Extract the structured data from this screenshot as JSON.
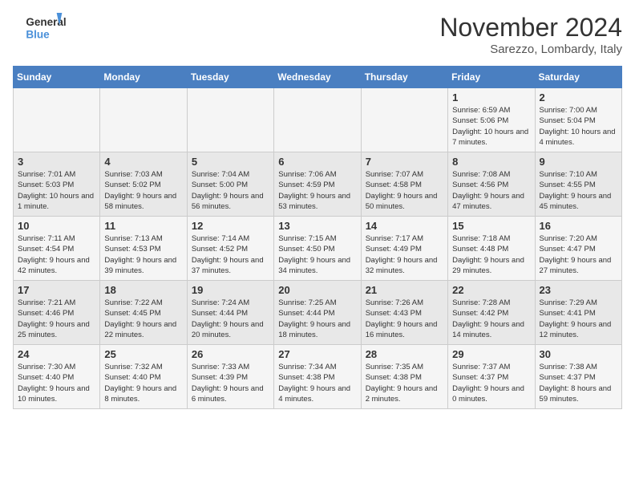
{
  "logo": {
    "line1": "General",
    "line2": "Blue"
  },
  "title": "November 2024",
  "location": "Sarezzo, Lombardy, Italy",
  "weekdays": [
    "Sunday",
    "Monday",
    "Tuesday",
    "Wednesday",
    "Thursday",
    "Friday",
    "Saturday"
  ],
  "weeks": [
    [
      {
        "day": "",
        "info": ""
      },
      {
        "day": "",
        "info": ""
      },
      {
        "day": "",
        "info": ""
      },
      {
        "day": "",
        "info": ""
      },
      {
        "day": "",
        "info": ""
      },
      {
        "day": "1",
        "info": "Sunrise: 6:59 AM\nSunset: 5:06 PM\nDaylight: 10 hours and 7 minutes."
      },
      {
        "day": "2",
        "info": "Sunrise: 7:00 AM\nSunset: 5:04 PM\nDaylight: 10 hours and 4 minutes."
      }
    ],
    [
      {
        "day": "3",
        "info": "Sunrise: 7:01 AM\nSunset: 5:03 PM\nDaylight: 10 hours and 1 minute."
      },
      {
        "day": "4",
        "info": "Sunrise: 7:03 AM\nSunset: 5:02 PM\nDaylight: 9 hours and 58 minutes."
      },
      {
        "day": "5",
        "info": "Sunrise: 7:04 AM\nSunset: 5:00 PM\nDaylight: 9 hours and 56 minutes."
      },
      {
        "day": "6",
        "info": "Sunrise: 7:06 AM\nSunset: 4:59 PM\nDaylight: 9 hours and 53 minutes."
      },
      {
        "day": "7",
        "info": "Sunrise: 7:07 AM\nSunset: 4:58 PM\nDaylight: 9 hours and 50 minutes."
      },
      {
        "day": "8",
        "info": "Sunrise: 7:08 AM\nSunset: 4:56 PM\nDaylight: 9 hours and 47 minutes."
      },
      {
        "day": "9",
        "info": "Sunrise: 7:10 AM\nSunset: 4:55 PM\nDaylight: 9 hours and 45 minutes."
      }
    ],
    [
      {
        "day": "10",
        "info": "Sunrise: 7:11 AM\nSunset: 4:54 PM\nDaylight: 9 hours and 42 minutes."
      },
      {
        "day": "11",
        "info": "Sunrise: 7:13 AM\nSunset: 4:53 PM\nDaylight: 9 hours and 39 minutes."
      },
      {
        "day": "12",
        "info": "Sunrise: 7:14 AM\nSunset: 4:52 PM\nDaylight: 9 hours and 37 minutes."
      },
      {
        "day": "13",
        "info": "Sunrise: 7:15 AM\nSunset: 4:50 PM\nDaylight: 9 hours and 34 minutes."
      },
      {
        "day": "14",
        "info": "Sunrise: 7:17 AM\nSunset: 4:49 PM\nDaylight: 9 hours and 32 minutes."
      },
      {
        "day": "15",
        "info": "Sunrise: 7:18 AM\nSunset: 4:48 PM\nDaylight: 9 hours and 29 minutes."
      },
      {
        "day": "16",
        "info": "Sunrise: 7:20 AM\nSunset: 4:47 PM\nDaylight: 9 hours and 27 minutes."
      }
    ],
    [
      {
        "day": "17",
        "info": "Sunrise: 7:21 AM\nSunset: 4:46 PM\nDaylight: 9 hours and 25 minutes."
      },
      {
        "day": "18",
        "info": "Sunrise: 7:22 AM\nSunset: 4:45 PM\nDaylight: 9 hours and 22 minutes."
      },
      {
        "day": "19",
        "info": "Sunrise: 7:24 AM\nSunset: 4:44 PM\nDaylight: 9 hours and 20 minutes."
      },
      {
        "day": "20",
        "info": "Sunrise: 7:25 AM\nSunset: 4:44 PM\nDaylight: 9 hours and 18 minutes."
      },
      {
        "day": "21",
        "info": "Sunrise: 7:26 AM\nSunset: 4:43 PM\nDaylight: 9 hours and 16 minutes."
      },
      {
        "day": "22",
        "info": "Sunrise: 7:28 AM\nSunset: 4:42 PM\nDaylight: 9 hours and 14 minutes."
      },
      {
        "day": "23",
        "info": "Sunrise: 7:29 AM\nSunset: 4:41 PM\nDaylight: 9 hours and 12 minutes."
      }
    ],
    [
      {
        "day": "24",
        "info": "Sunrise: 7:30 AM\nSunset: 4:40 PM\nDaylight: 9 hours and 10 minutes."
      },
      {
        "day": "25",
        "info": "Sunrise: 7:32 AM\nSunset: 4:40 PM\nDaylight: 9 hours and 8 minutes."
      },
      {
        "day": "26",
        "info": "Sunrise: 7:33 AM\nSunset: 4:39 PM\nDaylight: 9 hours and 6 minutes."
      },
      {
        "day": "27",
        "info": "Sunrise: 7:34 AM\nSunset: 4:38 PM\nDaylight: 9 hours and 4 minutes."
      },
      {
        "day": "28",
        "info": "Sunrise: 7:35 AM\nSunset: 4:38 PM\nDaylight: 9 hours and 2 minutes."
      },
      {
        "day": "29",
        "info": "Sunrise: 7:37 AM\nSunset: 4:37 PM\nDaylight: 9 hours and 0 minutes."
      },
      {
        "day": "30",
        "info": "Sunrise: 7:38 AM\nSunset: 4:37 PM\nDaylight: 8 hours and 59 minutes."
      }
    ]
  ]
}
